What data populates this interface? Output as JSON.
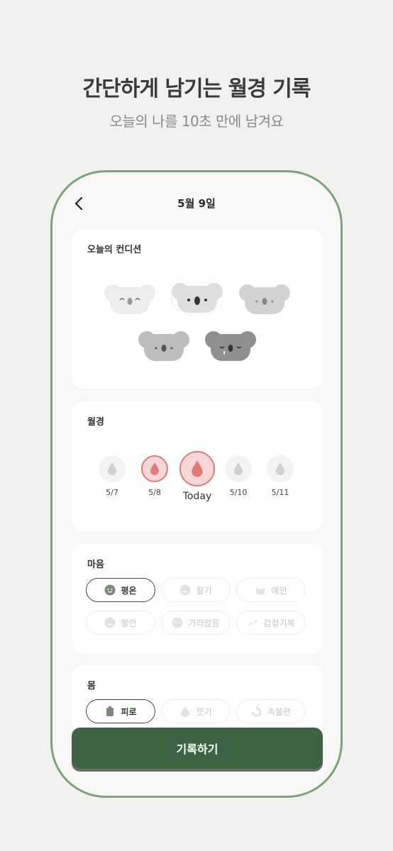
{
  "promo": {
    "headline": "간단하게 남기는 월경 기록",
    "subline": "오늘의 나를 10초 만에 남겨요"
  },
  "topbar": {
    "back_icon": "chevron-left-icon",
    "title": "5월 9일"
  },
  "condition": {
    "title": "오늘의 컨디션",
    "koalas": [
      {
        "icon": "koala-happy-icon",
        "tone": "#ededed"
      },
      {
        "icon": "koala-neutral-icon",
        "tone": "#dedede",
        "selected": true
      },
      {
        "icon": "koala-calm-icon",
        "tone": "#d2d2d2"
      },
      {
        "icon": "koala-tired-icon",
        "tone": "#bdbdbd"
      },
      {
        "icon": "koala-sad-icon",
        "tone": "#8f8f8f"
      }
    ]
  },
  "period": {
    "title": "월경",
    "days": [
      {
        "date": "5/7",
        "state": "none"
      },
      {
        "date": "5/8",
        "state": "light"
      },
      {
        "date": "Today",
        "state": "today"
      },
      {
        "date": "5/10",
        "state": "none"
      },
      {
        "date": "5/11",
        "state": "none"
      }
    ]
  },
  "mind": {
    "title": "마음",
    "chips": [
      {
        "label": "평온",
        "icon": "calm-face-icon",
        "active": true
      },
      {
        "label": "활기",
        "icon": "smile-face-icon",
        "active": false
      },
      {
        "label": "예민",
        "icon": "cat-face-icon",
        "active": false
      },
      {
        "label": "불안",
        "icon": "worried-face-icon",
        "active": false
      },
      {
        "label": "가라앉음",
        "icon": "sad-face-icon",
        "active": false
      },
      {
        "label": "감정기복",
        "icon": "trend-icon",
        "active": false
      }
    ]
  },
  "body": {
    "title": "몸",
    "chips": [
      {
        "label": "피로",
        "icon": "battery-icon",
        "active": true
      },
      {
        "label": "붓기",
        "icon": "drop-icon",
        "active": false
      },
      {
        "label": "속불편",
        "icon": "stomach-icon",
        "active": false
      }
    ]
  },
  "record_button": {
    "label": "기록하기"
  },
  "colors": {
    "accent_green": "#3e6343",
    "frame_green": "#7ea37c",
    "period_red": "#e07a7a",
    "period_fill": "#f6d6d6"
  }
}
